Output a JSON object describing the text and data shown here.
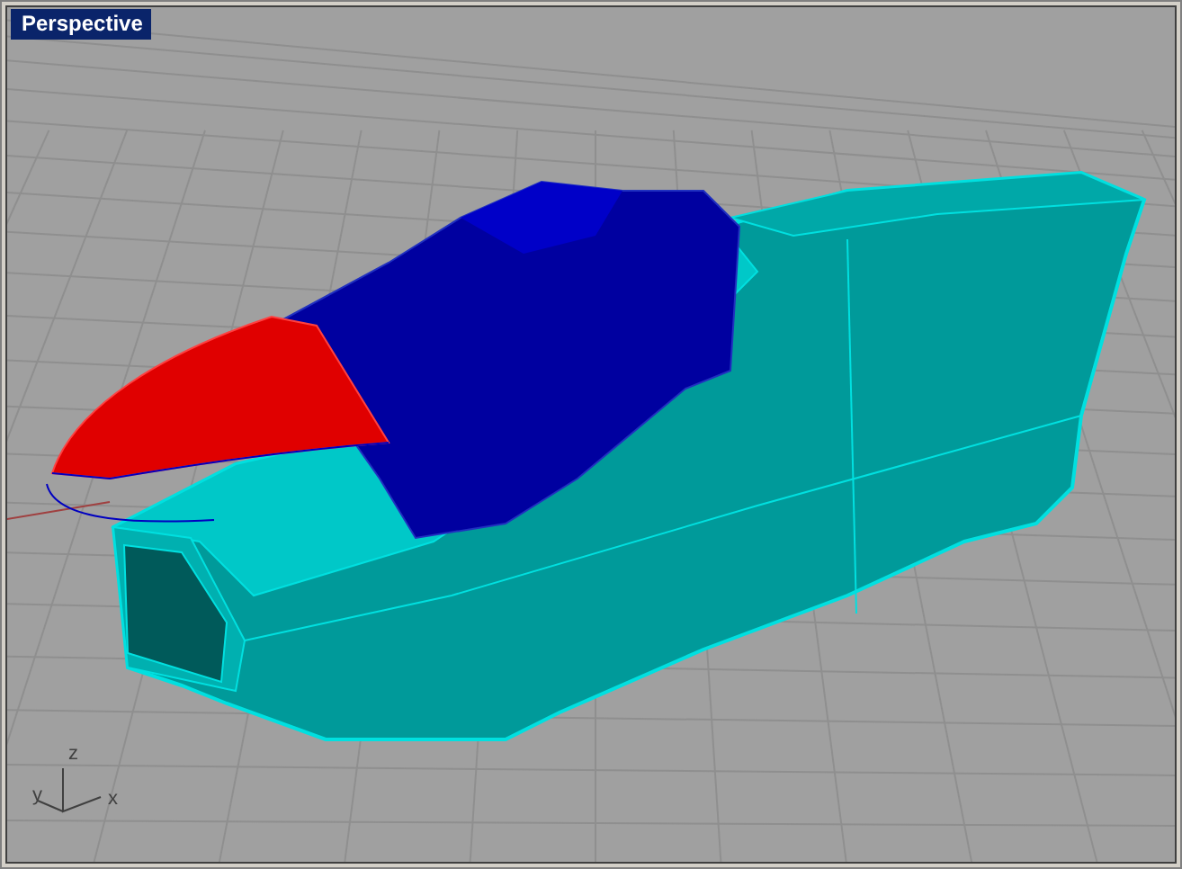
{
  "viewport": {
    "title": "Perspective",
    "active": true,
    "axes": {
      "z": "z",
      "y": "y",
      "x": "x"
    }
  }
}
